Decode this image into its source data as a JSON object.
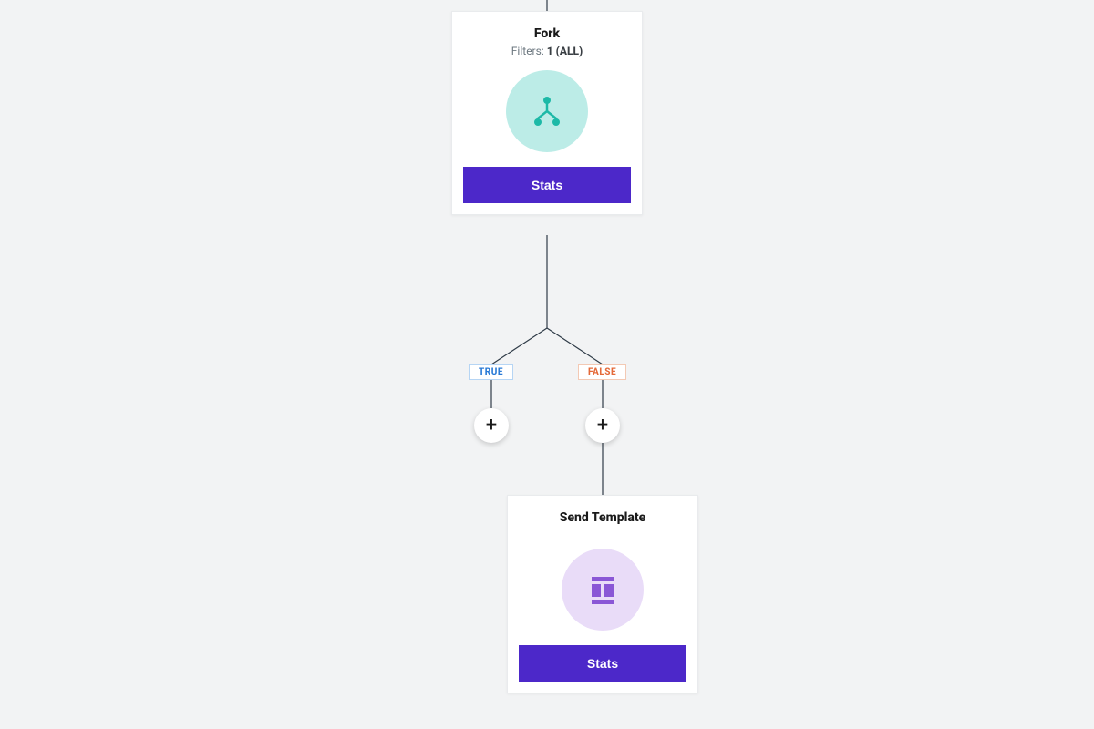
{
  "nodes": {
    "fork": {
      "title": "Fork",
      "filters_label": "Filters:",
      "filters_value": "1 (ALL)",
      "stats_label": "Stats",
      "icon_name": "fork-icon"
    },
    "send_template": {
      "title": "Send Template",
      "stats_label": "Stats",
      "icon_name": "template-icon"
    }
  },
  "branches": {
    "true_label": "TRUE",
    "false_label": "FALSE"
  },
  "colors": {
    "primary": "#4c28c9",
    "teal_bg": "#bcece7",
    "teal_fg": "#1db9a7",
    "lilac_bg": "#e9dcf8",
    "lilac_fg": "#8a57d6",
    "true": "#2b7bd6",
    "false": "#e46a3a",
    "connector": "#2f3b47"
  }
}
